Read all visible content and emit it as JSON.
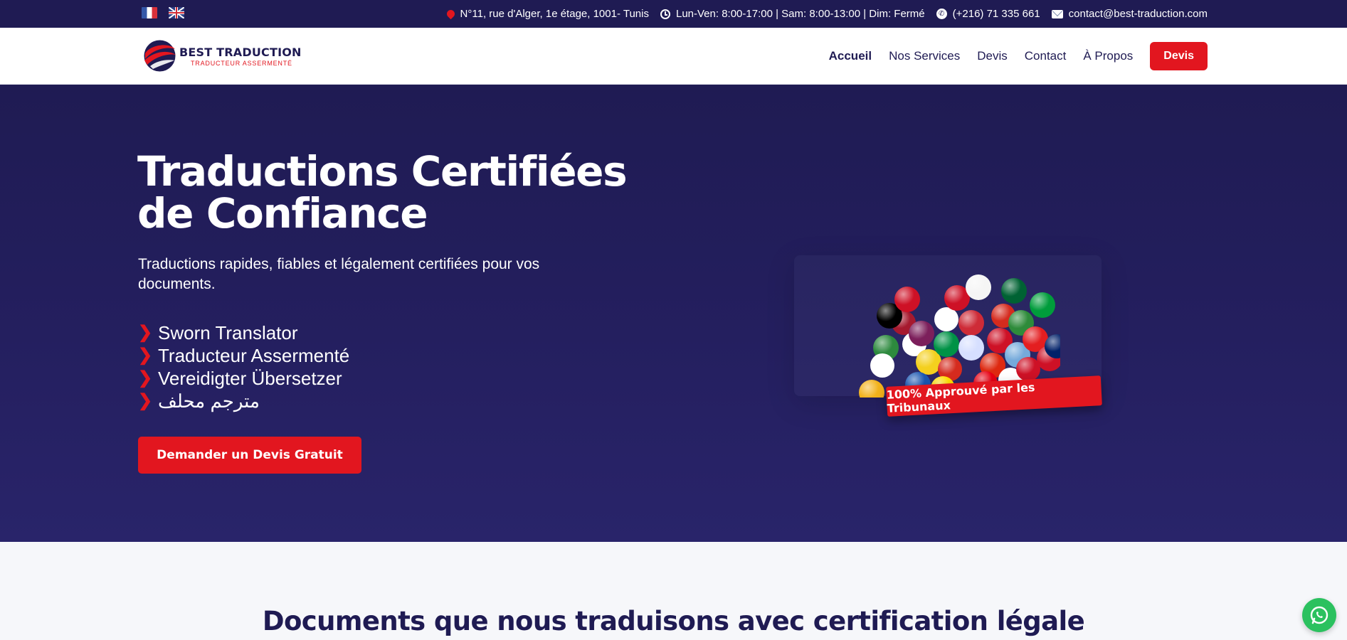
{
  "topbar": {
    "languages": [
      {
        "code": "fr",
        "icon": "flag-france-icon"
      },
      {
        "code": "en",
        "icon": "flag-uk-icon"
      }
    ],
    "address": "N°11, rue d'Alger, 1e étage, 1001- Tunis",
    "hours": "Lun-Ven: 8:00-17:00 | Sam: 8:00-13:00 | Dim: Fermé",
    "phone": "(+216) 71 335 661",
    "email": "contact@best-traduction.com"
  },
  "header": {
    "logo_title": "BEST TRADUCTION",
    "logo_subtitle": "TRADUCTEUR ASSERMENTÉ",
    "nav": [
      {
        "label": "Accueil",
        "active": true
      },
      {
        "label": "Nos Services",
        "active": false
      },
      {
        "label": "Devis",
        "active": false
      },
      {
        "label": "Contact",
        "active": false
      },
      {
        "label": "À Propos",
        "active": false
      }
    ],
    "cta_label": "Devis"
  },
  "hero": {
    "title_line1": "Traductions Certifiées",
    "title_line2": "de Confiance",
    "subtitle": "Traductions rapides, fiables et légalement certifiées pour vos documents.",
    "features": [
      "Sworn Translator",
      "Traducteur Assermenté",
      "Vereidigter Übersetzer",
      "مترجم محلف"
    ],
    "feature_marker": "❯",
    "cta_label": "Demander un Devis Gratuit",
    "badge": "100% Approuvé par les Tribunaux"
  },
  "section": {
    "title": "Documents que nous traduisons avec certification légale"
  },
  "colors": {
    "navy": "#1f1b53",
    "accent_red": "#e2161f",
    "whatsapp_green": "#2bc15f",
    "page_bg": "#f6f7fa"
  },
  "icons": {
    "address": "map-pin-icon",
    "hours": "clock-icon",
    "phone": "phone-icon",
    "email": "mail-icon",
    "whatsapp": "whatsapp-icon"
  }
}
